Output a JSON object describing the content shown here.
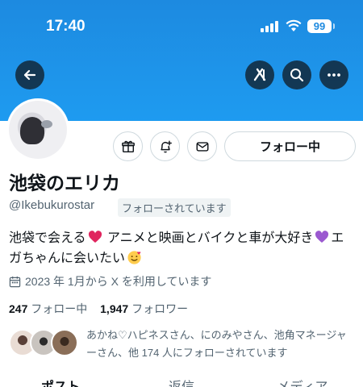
{
  "status": {
    "time": "17:40",
    "battery": "99"
  },
  "header": {
    "back_icon": "arrow-left-icon",
    "grok_icon": "grok-icon",
    "search_icon": "search-icon",
    "more_icon": "more-icon"
  },
  "profile": {
    "name": "池袋のエリカ",
    "handle": "@Ikebukurostar",
    "follows_you": "フォローされています",
    "bio_part1": "池袋で会える",
    "bio_part2": " アニメと映画とバイクと車が大好き",
    "bio_part3": "エガちゃんに会いたい",
    "joined": "2023 年 1月から X を利用しています",
    "following_count": "247",
    "following_label": "フォロー中",
    "followers_count": "1,947",
    "followers_label": "フォロワー",
    "followed_by": "あかね♡ハピネスさん、にのみやさん、池角マネージャーさん、他 174 人にフォローされています"
  },
  "actions": {
    "follow_label": "フォロー中",
    "gift_icon": "gift-icon",
    "notify_icon": "bell-plus-icon",
    "message_icon": "envelope-icon"
  },
  "tabs": [
    "ポスト",
    "返信",
    "メディア"
  ],
  "colors": {
    "banner": "#1d8ae0",
    "text": "#0f1419",
    "secondary": "#536471"
  }
}
